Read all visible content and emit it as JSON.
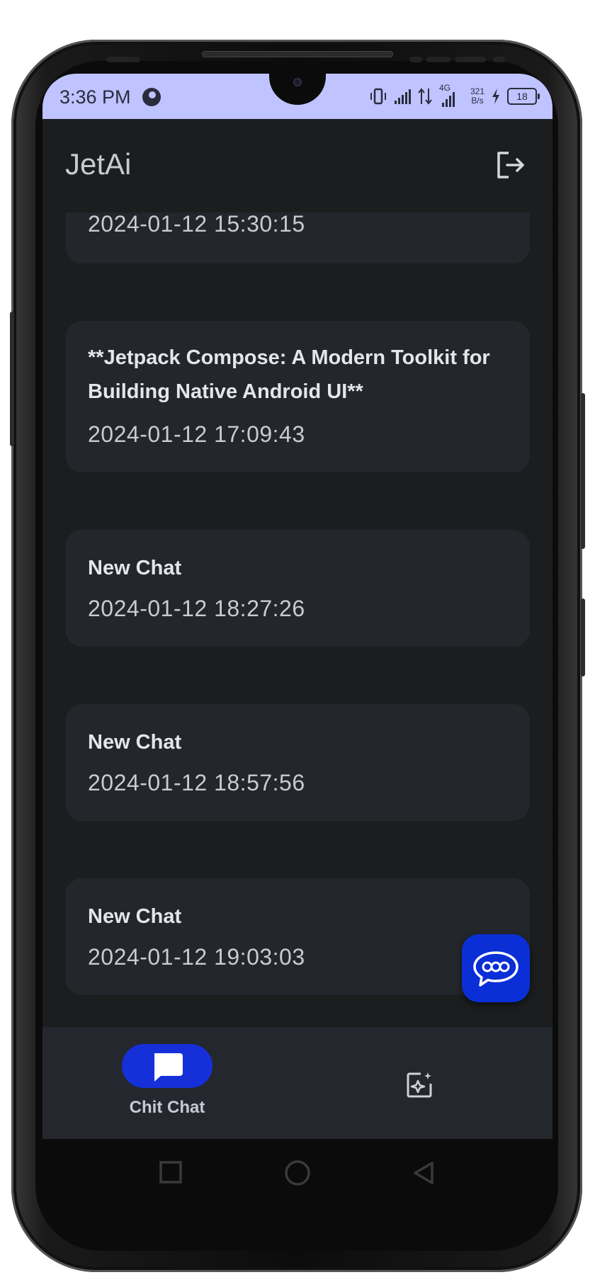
{
  "status_bar": {
    "time": "3:36 PM",
    "network_type": "4G",
    "net_speed_value": "321",
    "net_speed_unit": "B/s",
    "battery_level": "18"
  },
  "app_bar": {
    "title": "JetAi",
    "logout_icon": "logout-icon"
  },
  "chats": [
    {
      "title": "",
      "date": "2024-01-12 15:30:15"
    },
    {
      "title": "**Jetpack Compose: A Modern Toolkit for Building Native Android UI**",
      "date": "2024-01-12 17:09:43"
    },
    {
      "title": "New Chat",
      "date": "2024-01-12 18:27:26"
    },
    {
      "title": "New Chat",
      "date": "2024-01-12 18:57:56"
    },
    {
      "title": "New Chat",
      "date": "2024-01-12 19:03:03"
    }
  ],
  "fab": {
    "icon": "chat-bubble-dots-icon"
  },
  "bottom_nav": {
    "items": [
      {
        "label": "Chit Chat",
        "icon": "chat-icon",
        "selected": true
      },
      {
        "label": "",
        "icon": "ai-image-icon",
        "selected": false
      }
    ]
  },
  "system_nav": {
    "icons": [
      "recents-icon",
      "home-icon",
      "back-icon"
    ]
  },
  "colors": {
    "status_bar_bg": "#bfc3ff",
    "app_bg": "#1b1d1f",
    "card_bg": "#23262a",
    "accent": "#0a2fd6",
    "nav_bg": "#24272d"
  }
}
